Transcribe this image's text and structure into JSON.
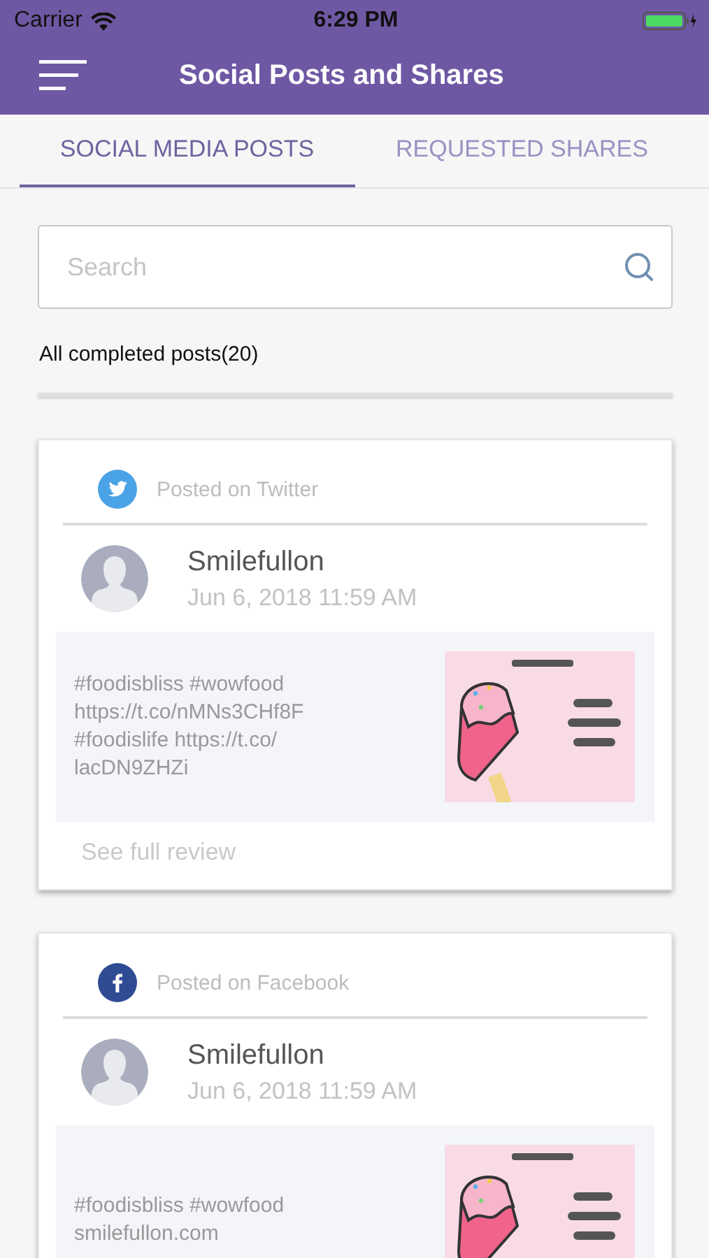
{
  "status_bar": {
    "carrier": "Carrier",
    "time": "6:29 PM"
  },
  "header": {
    "title": "Social Posts and Shares"
  },
  "tabs": [
    {
      "label": "SOCIAL MEDIA POSTS",
      "selected": true
    },
    {
      "label": "REQUESTED SHARES",
      "selected": false
    }
  ],
  "search": {
    "placeholder": "Search"
  },
  "summary": "All completed posts(20)",
  "posts": [
    {
      "kind": "twitter",
      "posted_on": "Posted on Twitter",
      "author": "Smilefullon",
      "date": "Jun 6, 2018 11:59 AM",
      "body": "#foodisbliss #wowfood\nhttps://t.co/nMNs3CHf8F\n#foodislife https://t.co/\nlacDN9ZHZi",
      "link": "See full review"
    },
    {
      "kind": "facebook",
      "posted_on": "Posted on Facebook",
      "author": "Smilefullon",
      "date": "Jun 6, 2018 11:59 AM",
      "body": "#foodisbliss #wowfood\nsmilefullon.com"
    }
  ]
}
